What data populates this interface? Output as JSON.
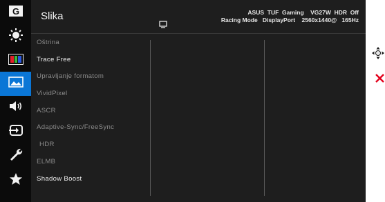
{
  "header": {
    "title": "Slika",
    "info_line1": "ASUS  TUF  Gaming    VG27W  HDR  Off",
    "info_line2": "Racing Mode   DisplayPort    2560x1440@   165Hz"
  },
  "sidebar": {
    "items": [
      {
        "icon": "gaming-g-icon",
        "active": false
      },
      {
        "icon": "brightness-sun-icon",
        "active": false
      },
      {
        "icon": "color-bars-icon",
        "active": false
      },
      {
        "icon": "image-picture-icon",
        "active": true
      },
      {
        "icon": "speaker-sound-icon",
        "active": false
      },
      {
        "icon": "input-source-icon",
        "active": false
      },
      {
        "icon": "wrench-system-icon",
        "active": false
      },
      {
        "icon": "star-favorite-icon",
        "active": false
      }
    ]
  },
  "menu": {
    "items": [
      {
        "label": "Oštrina",
        "enabled": false
      },
      {
        "label": "Trace Free",
        "enabled": true
      },
      {
        "label": "Upravljanje formatom",
        "enabled": false
      },
      {
        "label": "VividPixel",
        "enabled": false
      },
      {
        "label": "ASCR",
        "enabled": false
      },
      {
        "label": "Adaptive-Sync/FreeSync",
        "enabled": false
      },
      {
        "label": "HDR",
        "enabled": false
      },
      {
        "label": "ELMB",
        "enabled": false
      },
      {
        "label": "Shadow Boost",
        "enabled": true
      }
    ]
  },
  "controls": {
    "nav_icon": "joystick-navigation-icon",
    "close_icon": "close-x-icon",
    "close_color": "#e3001b",
    "accent": "#0a76d6"
  }
}
